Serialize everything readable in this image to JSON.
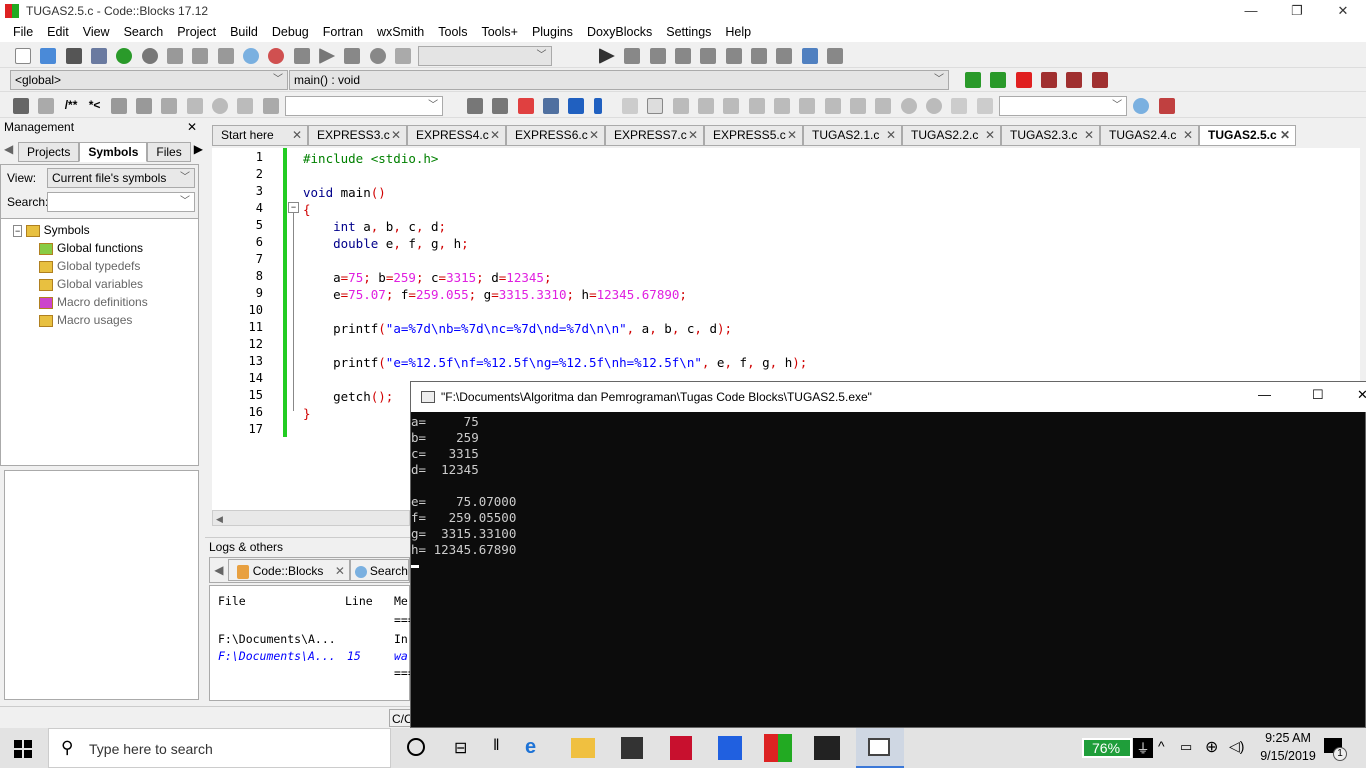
{
  "window": {
    "title": "TUGAS2.5.c - Code::Blocks 17.12",
    "min": "—",
    "max": "❐",
    "close": "✕"
  },
  "menu": [
    "File",
    "Edit",
    "View",
    "Search",
    "Project",
    "Build",
    "Debug",
    "Fortran",
    "wxSmith",
    "Tools",
    "Tools+",
    "Plugins",
    "DoxyBlocks",
    "Settings",
    "Help"
  ],
  "codebar": {
    "scope": "<global>",
    "function": "main() : void"
  },
  "doxy": {
    "block": "/**",
    "line": "*<"
  },
  "management": {
    "title": "Management",
    "tabs": [
      "Projects",
      "Symbols",
      "Files"
    ],
    "view_label": "View:",
    "view_value": "Current file's symbols",
    "search_label": "Search:",
    "search_value": "",
    "tree": {
      "root": "Symbols",
      "items": [
        "Global functions",
        "Global typedefs",
        "Global variables",
        "Macro definitions",
        "Macro usages"
      ]
    }
  },
  "editor_tabs": [
    "Start here",
    "EXPRESS3.c",
    "EXPRESS4.c",
    "EXPRESS6.c",
    "EXPRESS7.c",
    "EXPRESS5.c",
    "TUGAS2.1.c",
    "TUGAS2.2.c",
    "TUGAS2.3.c",
    "TUGAS2.4.c",
    "TUGAS2.5.c"
  ],
  "active_tab": "TUGAS2.5.c",
  "code_lines": [
    "1",
    "2",
    "3",
    "4",
    "5",
    "6",
    "7",
    "8",
    "9",
    "10",
    "11",
    "12",
    "13",
    "14",
    "15",
    "16",
    "17"
  ],
  "logs": {
    "title": "Logs & others",
    "tabs": [
      "Code::Blocks",
      "Search"
    ],
    "headers": [
      "File",
      "Line",
      "Me"
    ],
    "rows": [
      {
        "file": "",
        "line": "",
        "msg": "==="
      },
      {
        "file": "F:\\Documents\\A...",
        "line": "",
        "msg": "In"
      },
      {
        "file": "F:\\Documents\\A...",
        "line": "15",
        "msg": "wa"
      },
      {
        "file": "",
        "line": "",
        "msg": "==="
      }
    ]
  },
  "status": {
    "lang": "C/C"
  },
  "console": {
    "title": "\"F:\\Documents\\Algoritma dan Pemrograman\\Tugas Code Blocks\\TUGAS2.5.exe\"",
    "output": [
      "a=     75",
      "b=    259",
      "c=   3315",
      "d=  12345",
      "",
      "e=    75.07000",
      "f=   259.05500",
      "g=  3315.33100",
      "h= 12345.67890"
    ]
  },
  "taskbar": {
    "search_placeholder": "Type here to search",
    "battery": "76%",
    "time": "9:25 AM",
    "date": "9/15/2019",
    "notifications": "1"
  },
  "colors": {
    "keyword": "#00008b",
    "number": "#e020e0",
    "string": "#0000ff",
    "preprocessor": "#008000",
    "change_bar": "#22cc22",
    "battery": "#1f9e3a"
  }
}
